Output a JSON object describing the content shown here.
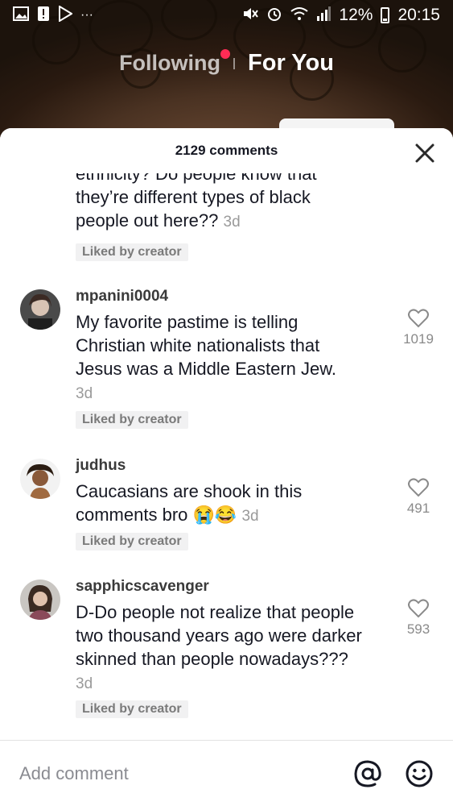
{
  "status_bar": {
    "battery_percent": "12%",
    "time": "20:15",
    "left_icons": [
      "image-icon",
      "alert-icon",
      "play-store-icon",
      "more-dots-icon"
    ],
    "right_icons": [
      "mute-icon",
      "alarm-icon",
      "wifi-icon",
      "signal-icon",
      "battery-icon"
    ]
  },
  "top_tabs": {
    "following": "Following",
    "for_you": "For You"
  },
  "sheet": {
    "comment_count_label": "2129 comments"
  },
  "comments": [
    {
      "username": "",
      "text": "ethnicity? Do people know that they’re different types of black people out here??",
      "timestamp": "3d",
      "badge": "Liked by creator"
    },
    {
      "username": "mpanini0004",
      "text": "My favorite pastime is telling Christian white nationalists that Jesus was a Middle Eastern Jew.",
      "timestamp": "3d",
      "badge": "Liked by creator",
      "likes": "1019"
    },
    {
      "username": "judhus",
      "text": "Caucasians are shook in this comments bro",
      "emojis": "😭😂",
      "timestamp": "3d",
      "badge": "Liked by creator",
      "likes": "491"
    },
    {
      "username": "sapphicscavenger",
      "text": "D-Do people not realize that people two thousand years ago were darker skinned than people nowadays???",
      "timestamp": "3d",
      "badge": "Liked by creator",
      "likes": "593"
    }
  ],
  "input": {
    "placeholder": "Add comment"
  },
  "colors": {
    "accent": "#fe2c55",
    "text": "#161823",
    "muted": "#8a8b91"
  }
}
